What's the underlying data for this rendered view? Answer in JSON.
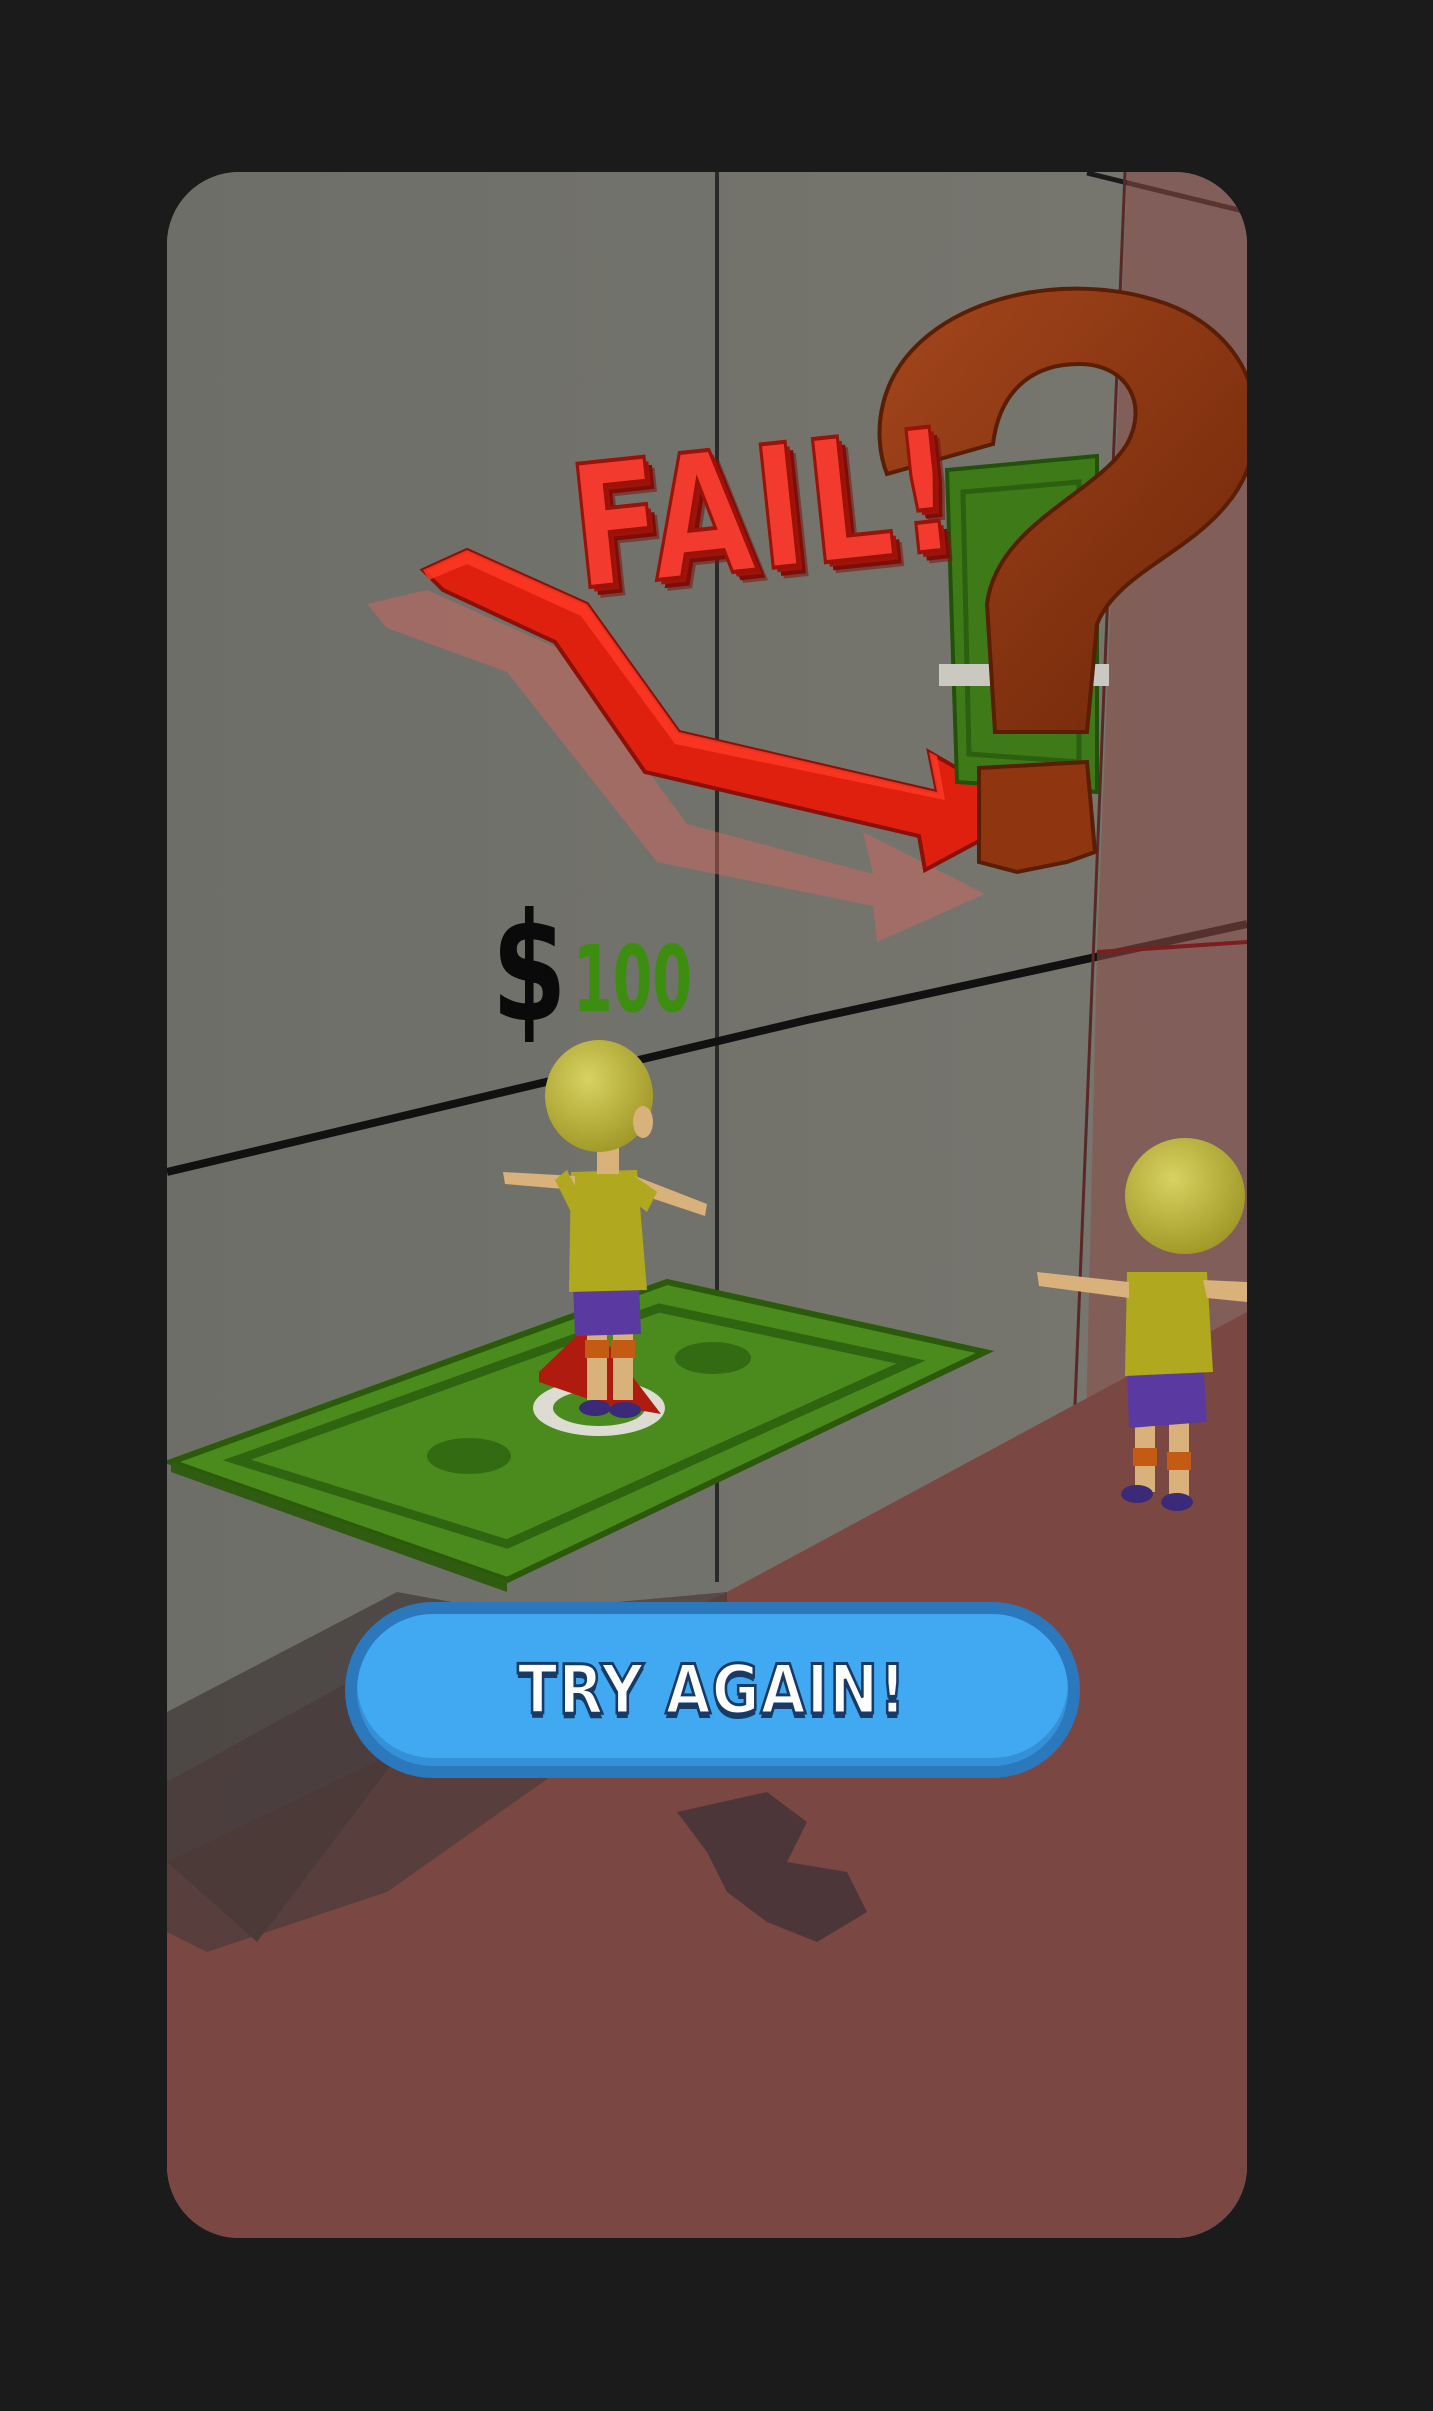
{
  "game": {
    "result_title": "FAIL!",
    "money_symbol": "$",
    "money_amount": "100",
    "try_again_label": "TRY AGAIN!"
  },
  "colors": {
    "background": "#1b1b1b",
    "fail_red": "#f23b2e",
    "money_green": "#3d8e10",
    "button_blue": "#41a9f1",
    "button_border": "#2b78bd",
    "floor_red": "#7a4743",
    "question_mark_brown": "#8b3410"
  },
  "icons": {
    "fail_arrow": "red-bent-arrow-icon",
    "question_mark": "question-mark-icon",
    "bill": "dollar-bill-icon"
  }
}
